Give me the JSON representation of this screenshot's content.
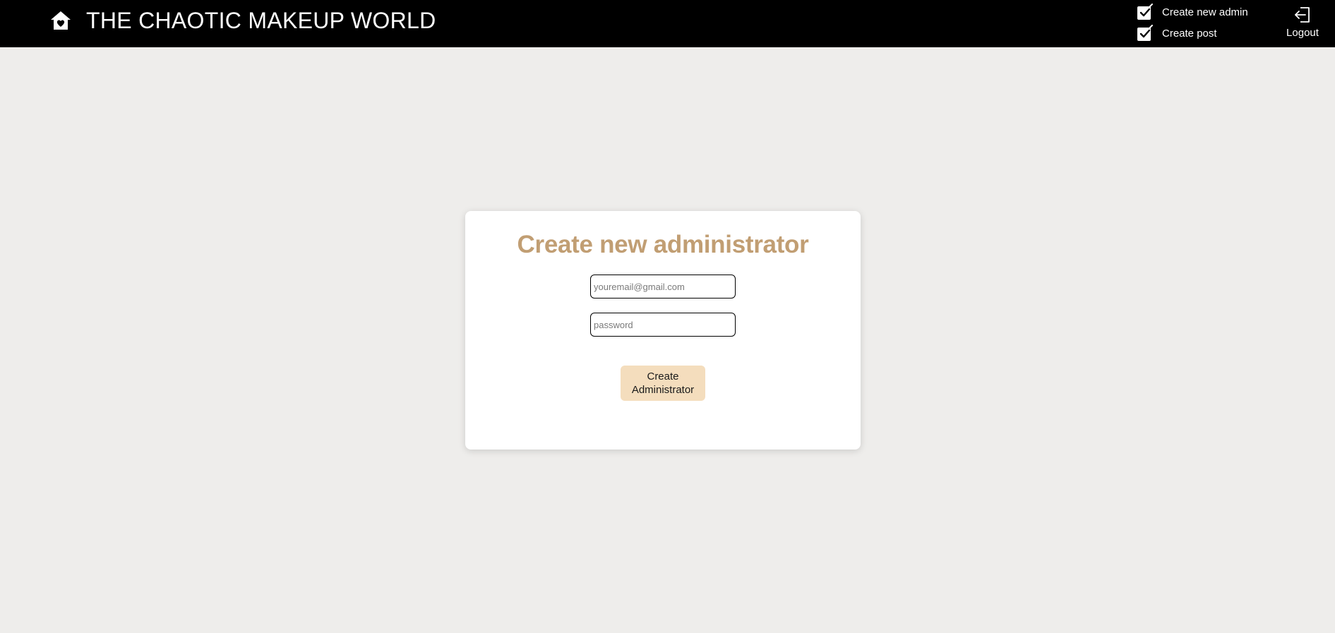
{
  "header": {
    "brand_title": "THE CHAOTIC MAKEUP WORLD",
    "home_icon": "home-heart-icon",
    "nav": [
      {
        "label": "Create new admin",
        "icon": "edit-icon"
      },
      {
        "label": "Create post",
        "icon": "edit-icon"
      }
    ],
    "logout_label": "Logout",
    "logout_icon": "logout-icon"
  },
  "form": {
    "title": "Create new administrator",
    "email_placeholder": "youremail@gmail.com",
    "email_value": "",
    "password_placeholder": "password",
    "password_value": "",
    "submit_label": "Create Administrator"
  },
  "colors": {
    "topbar": "#000000",
    "background": "#eeedeb",
    "title_accent": "#c19e73",
    "button_bg": "#f4ddbd"
  }
}
